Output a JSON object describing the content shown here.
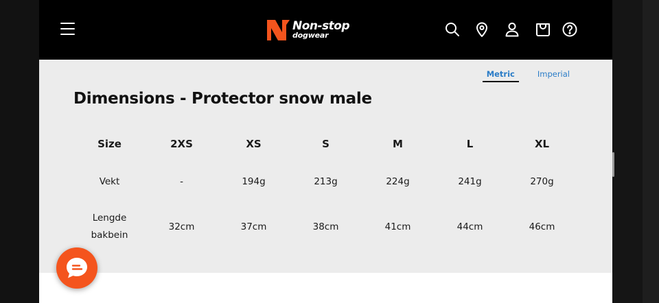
{
  "brand": {
    "logo_text_line1": "Non-stop",
    "logo_text_line2": "dogwear",
    "accent_color": "#f4541d"
  },
  "header": {
    "icons": [
      "menu-icon",
      "search-icon",
      "location-icon",
      "account-icon",
      "cart-icon",
      "help-icon"
    ]
  },
  "units": {
    "tabs": [
      {
        "label": "Metric",
        "active": true
      },
      {
        "label": "Imperial",
        "active": false
      }
    ]
  },
  "dimensions": {
    "title": "Dimensions - Protector snow male",
    "header": [
      "Size",
      "2XS",
      "XS",
      "S",
      "M",
      "L",
      "XL"
    ],
    "rows": [
      {
        "label": "Vekt",
        "values": [
          "-",
          "194g",
          "213g",
          "224g",
          "241g",
          "270g"
        ]
      },
      {
        "label_line1": "Lengde",
        "label_line2": "bakbein",
        "values": [
          "32cm",
          "37cm",
          "38cm",
          "41cm",
          "44cm",
          "46cm"
        ]
      }
    ]
  },
  "chat": {
    "icon": "chat-icon"
  }
}
